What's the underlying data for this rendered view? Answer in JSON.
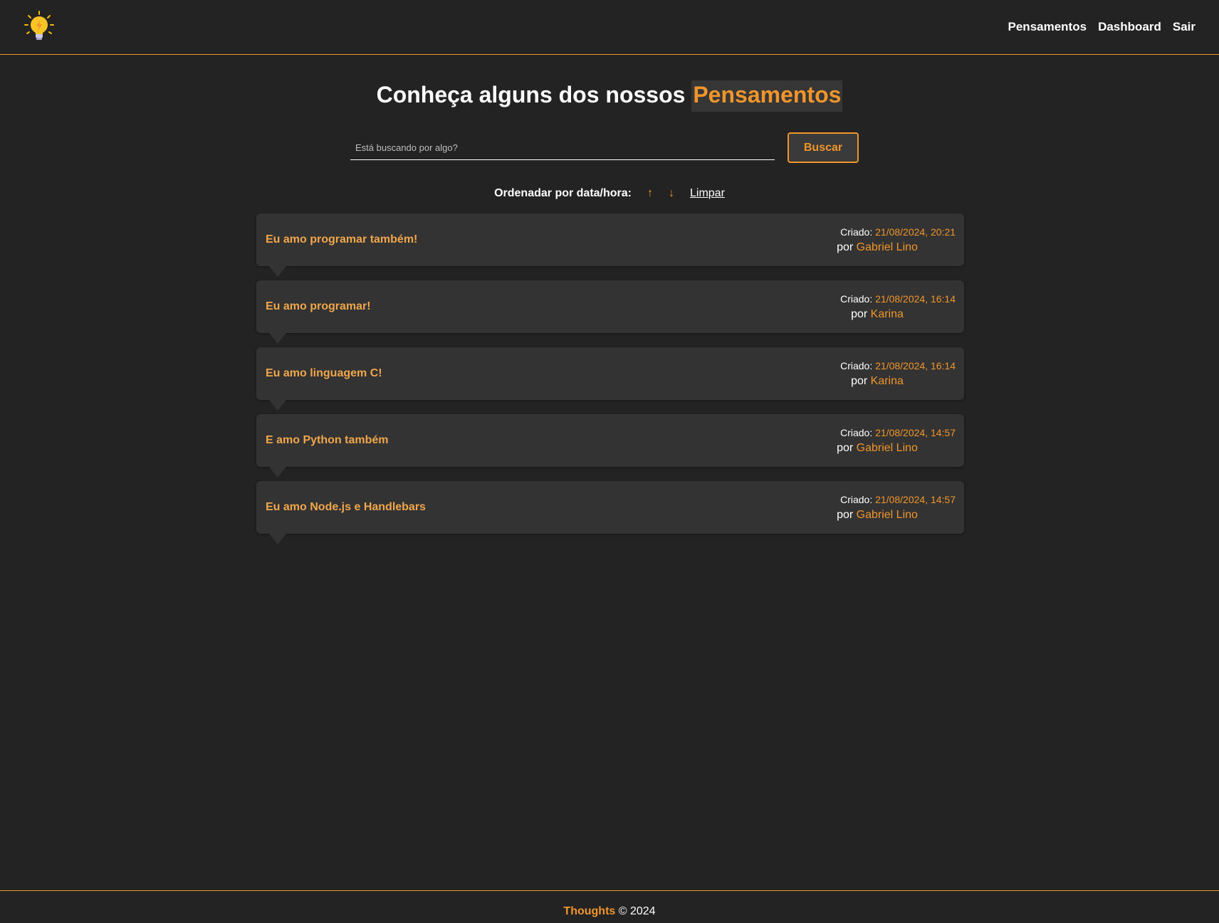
{
  "nav": {
    "logo": "lightbulb-icon",
    "links": [
      "Pensamentos",
      "Dashboard",
      "Sair"
    ]
  },
  "hero": {
    "title_prefix": "Conheça alguns dos nossos",
    "title_accent": "Pensamentos"
  },
  "search": {
    "placeholder": "Está buscando por algo?",
    "value": "",
    "button_label": "Buscar"
  },
  "order": {
    "label": "Ordenadar por data/hora:",
    "asc_icon": "↑",
    "desc_icon": "↓",
    "clear_label": "Limpar"
  },
  "thoughts": [
    {
      "title": "Eu amo programar também!",
      "created_label": "Criado:",
      "date": "21/08/2024, 20:21",
      "by_label": "por",
      "author": "Gabriel Lino"
    },
    {
      "title": "Eu amo programar!",
      "created_label": "Criado:",
      "date": "21/08/2024, 16:14",
      "by_label": "por",
      "author": "Karina"
    },
    {
      "title": "Eu amo linguagem C!",
      "created_label": "Criado:",
      "date": "21/08/2024, 16:14",
      "by_label": "por",
      "author": "Karina"
    },
    {
      "title": "E amo Python também",
      "created_label": "Criado:",
      "date": "21/08/2024, 14:57",
      "by_label": "por",
      "author": "Gabriel Lino"
    },
    {
      "title": "Eu amo Node.js e Handlebars",
      "created_label": "Criado:",
      "date": "21/08/2024, 14:57",
      "by_label": "por",
      "author": "Gabriel Lino"
    }
  ],
  "footer": {
    "brand": "Thoughts",
    "copyright": "© 2024"
  },
  "colors": {
    "background": "#232323",
    "accent": "#f0952b",
    "card": "#333333"
  }
}
